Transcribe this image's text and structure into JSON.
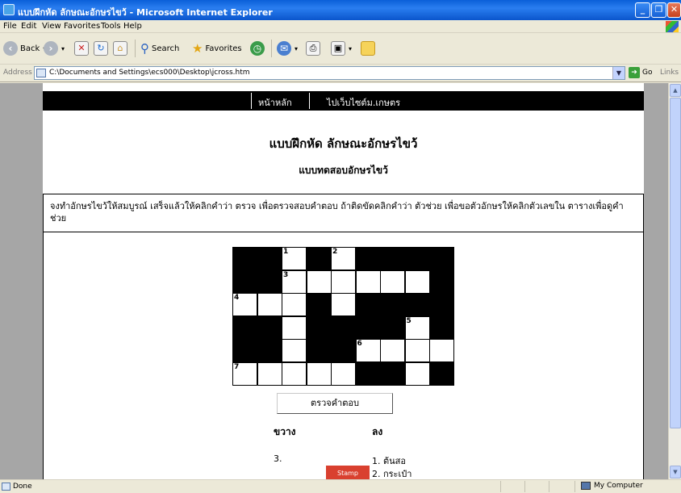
{
  "window": {
    "title": "แบบฝึกหัด ลักษณะอักษรไขว้ - Microsoft Internet Explorer"
  },
  "menu": {
    "items": [
      "File",
      "Edit",
      "View",
      "Favorites",
      "Tools",
      "Help"
    ]
  },
  "toolbar": {
    "back": "Back",
    "search": "Search",
    "favorites": "Favorites"
  },
  "address": {
    "label": "Address",
    "value": "C:\\Documents and Settings\\ecs000\\Desktop\\jcross.htm",
    "go": "Go",
    "links": "Links"
  },
  "page": {
    "nav": [
      "หน้าหลัก",
      "ไปเว็บไซต์ม.เกษตร"
    ],
    "title": "แบบฝึกหัด ลักษณะอักษรไขว้",
    "subtitle": "แบบทดสอบอักษรไขว้",
    "instructions": "จงทำอักษรไขว้ให้สมบูรณ์ เสร็จแล้วให้คลิกคำว่า ตรวจ เพื่อตรวจสอบคำตอบ ถ้าติดขัดคลิกคำว่า ตัวช่วย เพื่อขอตัวอักษรให้คลิกตัวเลขใน ตารางเพื่อดูคำช่วย",
    "check_button": "ตรวจคำตอบ",
    "across_heading": "ขวาง",
    "down_heading": "ลง",
    "across_clues": [
      "3."
    ],
    "down_clues": [
      "1. ต้นสอ",
      "2. กระเป๋า"
    ],
    "promo_text": "Stamp"
  },
  "crossword": {
    "rows": 6,
    "cols": 9,
    "cells": [
      [
        "B",
        "B",
        "W",
        "B",
        "W",
        "B",
        "B",
        "B",
        "B"
      ],
      [
        "B",
        "B",
        "W",
        "W",
        "W",
        "W",
        "W",
        "W",
        "B"
      ],
      [
        "W",
        "W",
        "W",
        "B",
        "W",
        "B",
        "B",
        "B",
        "B"
      ],
      [
        "B",
        "B",
        "W",
        "B",
        "B",
        "B",
        "B",
        "W",
        "B"
      ],
      [
        "B",
        "B",
        "W",
        "B",
        "B",
        "W",
        "W",
        "W",
        "W"
      ],
      [
        "W",
        "W",
        "W",
        "W",
        "W",
        "B",
        "B",
        "W",
        "B"
      ]
    ],
    "numbers": [
      {
        "row": 0,
        "col": 2,
        "n": "1"
      },
      {
        "row": 0,
        "col": 4,
        "n": "2"
      },
      {
        "row": 1,
        "col": 2,
        "n": "3"
      },
      {
        "row": 2,
        "col": 0,
        "n": "4"
      },
      {
        "row": 3,
        "col": 7,
        "n": "5"
      },
      {
        "row": 4,
        "col": 5,
        "n": "6"
      },
      {
        "row": 5,
        "col": 0,
        "n": "7"
      }
    ]
  },
  "status": {
    "left": "Done",
    "zone": "My Computer"
  }
}
